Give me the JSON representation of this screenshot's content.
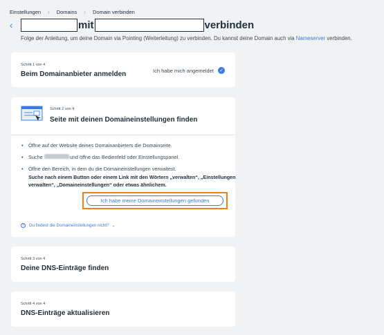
{
  "breadcrumb": {
    "items": [
      "Einstellungen",
      "Domains",
      "Domain verbinden"
    ]
  },
  "title": {
    "connector": "mit",
    "verb": "verbinden"
  },
  "subtitle": {
    "text": "Folge der Anleitung, um deine Domain via Pointing (Weiterleitung) zu verbinden. Du kannst deine Domain auch via ",
    "link": "Nameserver",
    "suffix": " verbinden."
  },
  "steps": [
    {
      "label": "Schritt 1 von 4",
      "title": "Beim Domainanbieter anmelden",
      "status": "Ich habe mich angemeldet",
      "status_icon": "check-circle-icon"
    },
    {
      "label": "Schritt 2 von 4",
      "title": "Seite mit deinen Domaineinstellungen finden",
      "bullets": [
        "Öffne auf der Website deines Domainanbieters die Domainseite.",
        "Suche",
        "und öffne das Bedienfeld oder Einstellungspanel.",
        "Öffne den Bereich, in dem du die Domaineinstellungen verwaltest."
      ],
      "bold_text": "Suche nach einem Button oder einem Link mit den Wörtern „verwalten“, „Einstellungen verwalten“, „Domaineinstellungen“ oder etwas ähnlichem.",
      "button": "Ich habe meine Domaineinstellungen gefunden",
      "help_link": "Du findest die Domaineinstellungen nicht?"
    },
    {
      "label": "Schritt 3 von 4",
      "title": "Deine DNS-Einträge finden"
    },
    {
      "label": "Schritt 4 von 4",
      "title": "DNS-Einträge aktualisieren"
    }
  ],
  "colors": {
    "accent": "#3a79e8",
    "highlight": "#f0800f",
    "background": "#f1f2f4"
  }
}
